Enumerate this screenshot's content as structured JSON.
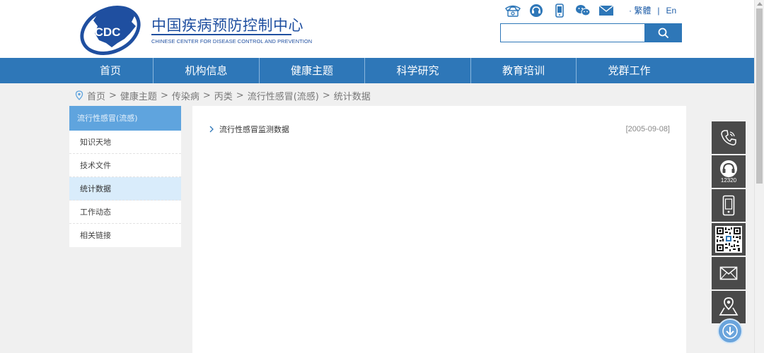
{
  "header": {
    "logo_text": "CDC",
    "title_cn": "中国疾病预防控制中心",
    "title_en": "CHINESE CENTER FOR DISEASE CONTROL AND PREVENTION",
    "top_icons": [
      "phone-icon",
      "hotline-icon",
      "mobile-icon",
      "wechat-icon",
      "mail-icon"
    ],
    "lang_traditional": "· 繁體",
    "lang_sep": "|",
    "lang_english": "En",
    "search_placeholder": ""
  },
  "nav": {
    "items": [
      {
        "label": "首页"
      },
      {
        "label": "机构信息"
      },
      {
        "label": "健康主题"
      },
      {
        "label": "科学研究"
      },
      {
        "label": "教育培训"
      },
      {
        "label": "党群工作"
      }
    ]
  },
  "breadcrumb": {
    "items": [
      "首页",
      "健康主题",
      "传染病",
      "丙类",
      "流行性感冒(流感)",
      "统计数据"
    ],
    "separator": ">"
  },
  "sidebar": {
    "heading": "流行性感冒(流感)",
    "items": [
      {
        "label": "知识天地",
        "active": false
      },
      {
        "label": "技术文件",
        "active": false
      },
      {
        "label": "统计数据",
        "active": true
      },
      {
        "label": "工作动态",
        "active": false
      },
      {
        "label": "相关链接",
        "active": false
      }
    ]
  },
  "main": {
    "articles": [
      {
        "title": "流行性感冒监测数据",
        "date": "[2005-09-08]"
      }
    ]
  },
  "float_bar": {
    "buttons": [
      {
        "icon": "phone-icon",
        "label": ""
      },
      {
        "icon": "headset-icon",
        "label": "12320"
      },
      {
        "icon": "mobile-icon",
        "label": ""
      },
      {
        "icon": "qr-code-icon",
        "label": ""
      },
      {
        "icon": "mail-icon",
        "label": ""
      },
      {
        "icon": "map-location-icon",
        "label": ""
      }
    ]
  },
  "colors": {
    "brand_blue": "#2e77b8",
    "logo_blue": "#1f4fa0",
    "sidebar_head": "#5fa4de",
    "sidebar_active": "#d9ecfb",
    "float_bg": "#4a4a4a"
  }
}
